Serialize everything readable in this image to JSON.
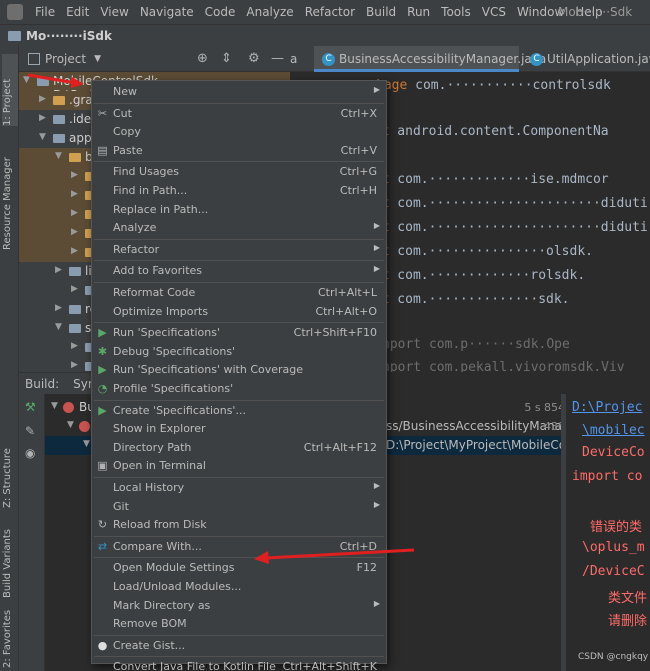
{
  "menubar": {
    "items": [
      "File",
      "Edit",
      "View",
      "Navigate",
      "Code",
      "Analyze",
      "Refactor",
      "Build",
      "Run",
      "Tools",
      "VCS",
      "Window",
      "Help"
    ],
    "window_title": "Mob·······Sdk"
  },
  "breadcrumb": {
    "project": "Mo········iSdk"
  },
  "left_strip": {
    "project_tab": "1: Project",
    "resource_manager_tab": "Resource Manager",
    "structure_tab": "Z: Structure",
    "build_variants_tab": "Build Variants",
    "favorites_tab": "2: Favorites"
  },
  "project_panel": {
    "title": "Project"
  },
  "tree": [
    {
      "label": "MobileControlSdk D:\\Project\\MyProject\\Mo...",
      "highlight": "hl"
    },
    {
      "label": ".grad",
      "highlight": "hl"
    },
    {
      "label": ".idea",
      "highlight": ""
    },
    {
      "label": "app",
      "highlight": ""
    },
    {
      "label": "b",
      "highlight": "hl"
    },
    {
      "label": "",
      "highlight": "hl"
    },
    {
      "label": "",
      "highlight": "hl"
    },
    {
      "label": "",
      "highlight": "hl"
    },
    {
      "label": "",
      "highlight": "hl"
    },
    {
      "label": "",
      "highlight": "hl"
    },
    {
      "label": "li",
      "highlight": ""
    },
    {
      "label": "",
      "highlight": ""
    },
    {
      "label": "re",
      "highlight": ""
    },
    {
      "label": "sr",
      "highlight": ""
    },
    {
      "label": "",
      "highlight": ""
    },
    {
      "label": "",
      "highlight": ""
    }
  ],
  "build_tabs": {
    "build_label": "Build:",
    "sync_label": "Sync"
  },
  "build_rows": [
    {
      "label": "Bu",
      "time": "5 s 854 ms",
      "path": ""
    },
    {
      "label": "",
      "time": "438 ms",
      "path": "ss/BusinessAccessibilityManager.java"
    },
    {
      "label": "",
      "time": "",
      "path": "D:\\Project\\MyProject\\MobileContro"
    }
  ],
  "output_lines": [
    "D:\\Projec",
    "\\mobilec",
    "DeviceCo",
    "import co",
    "错误的类",
    "\\oplus_m",
    "/DeviceC",
    "类文件",
    "请删除"
  ],
  "editor_tabs": {
    "first": "a",
    "active": "BusinessAccessibilityManager.java",
    "third": "UtilApplication.java"
  },
  "code_lines": [
    {
      "kw": "kage",
      "text": " com.···········controlsdk"
    },
    {
      "kw": "ort",
      "text": " android.content.ComponentNa"
    },
    {
      "kw": "ort",
      "text": " com.·············ise.mdmcor"
    },
    {
      "kw": "ort",
      "text": " com.······················diduti"
    },
    {
      "kw": "ort",
      "text": " com.······················diduti"
    },
    {
      "kw": "ort",
      "text": " com.···············olsdk."
    },
    {
      "kw": "ort",
      "text": " com.·············rolsdk."
    },
    {
      "kw": "ort",
      "text": " com.··············sdk."
    },
    {
      "kw": "",
      "text": "nport com.p······sdk.Ope"
    },
    {
      "kw": "",
      "text": "nport com.pekall.vivoromsdk.Viv"
    }
  ],
  "context_menu": [
    {
      "label": "New",
      "shortcut": "",
      "submenu": true,
      "icon": "",
      "icon_color": ""
    },
    {
      "sep": true
    },
    {
      "label": "Cut",
      "shortcut": "Ctrl+X",
      "submenu": false,
      "icon": "✂",
      "icon_color": "#afb1b3"
    },
    {
      "label": "Copy",
      "shortcut": "",
      "submenu": false,
      "icon": "",
      "icon_color": ""
    },
    {
      "label": "Paste",
      "shortcut": "Ctrl+V",
      "submenu": false,
      "icon": "▤",
      "icon_color": "#afb1b3"
    },
    {
      "sep": true
    },
    {
      "label": "Find Usages",
      "shortcut": "Ctrl+G",
      "submenu": false,
      "icon": "",
      "icon_color": ""
    },
    {
      "label": "Find in Path...",
      "shortcut": "Ctrl+H",
      "submenu": false,
      "icon": "",
      "icon_color": ""
    },
    {
      "label": "Replace in Path...",
      "shortcut": "",
      "submenu": false,
      "icon": "",
      "icon_color": ""
    },
    {
      "label": "Analyze",
      "shortcut": "",
      "submenu": true,
      "icon": "",
      "icon_color": ""
    },
    {
      "sep": true
    },
    {
      "label": "Refactor",
      "shortcut": "",
      "submenu": true,
      "icon": "",
      "icon_color": ""
    },
    {
      "sep": true
    },
    {
      "label": "Add to Favorites",
      "shortcut": "",
      "submenu": true,
      "icon": "",
      "icon_color": ""
    },
    {
      "sep": true
    },
    {
      "label": "Reformat Code",
      "shortcut": "Ctrl+Alt+L",
      "submenu": false,
      "icon": "",
      "icon_color": ""
    },
    {
      "label": "Optimize Imports",
      "shortcut": "Ctrl+Alt+O",
      "submenu": false,
      "icon": "",
      "icon_color": ""
    },
    {
      "sep": true
    },
    {
      "label": "Run 'Specifications'",
      "shortcut": "Ctrl+Shift+F10",
      "submenu": false,
      "icon": "▶",
      "icon_color": "#59a869"
    },
    {
      "label": "Debug 'Specifications'",
      "shortcut": "",
      "submenu": false,
      "icon": "✱",
      "icon_color": "#59a869"
    },
    {
      "label": "Run 'Specifications' with Coverage",
      "shortcut": "",
      "submenu": false,
      "icon": "▶",
      "icon_color": "#59a869"
    },
    {
      "label": "Profile 'Specifications'",
      "shortcut": "",
      "submenu": false,
      "icon": "◔",
      "icon_color": "#59a869"
    },
    {
      "sep": true
    },
    {
      "label": "Create 'Specifications'...",
      "shortcut": "",
      "submenu": false,
      "icon": "▶",
      "icon_color": "#59a869"
    },
    {
      "label": "Show in Explorer",
      "shortcut": "",
      "submenu": false,
      "icon": "",
      "icon_color": ""
    },
    {
      "label": "Directory Path",
      "shortcut": "Ctrl+Alt+F12",
      "submenu": false,
      "icon": "",
      "icon_color": ""
    },
    {
      "label": "Open in Terminal",
      "shortcut": "",
      "submenu": false,
      "icon": "▣",
      "icon_color": "#afb1b3"
    },
    {
      "sep": true
    },
    {
      "label": "Local History",
      "shortcut": "",
      "submenu": true,
      "icon": "",
      "icon_color": ""
    },
    {
      "label": "Git",
      "shortcut": "",
      "submenu": true,
      "icon": "",
      "icon_color": ""
    },
    {
      "label": "Reload from Disk",
      "shortcut": "",
      "submenu": false,
      "icon": "↻",
      "icon_color": "#afb1b3"
    },
    {
      "sep": true
    },
    {
      "label": "Compare With...",
      "shortcut": "Ctrl+D",
      "submenu": false,
      "icon": "⇄",
      "icon_color": "#3592c4"
    },
    {
      "sep": true
    },
    {
      "label": "Open Module Settings",
      "shortcut": "F12",
      "submenu": false,
      "icon": "",
      "icon_color": ""
    },
    {
      "label": "Load/Unload Modules...",
      "shortcut": "",
      "submenu": false,
      "icon": "",
      "icon_color": ""
    },
    {
      "label": "Mark Directory as",
      "shortcut": "",
      "submenu": true,
      "icon": "",
      "icon_color": ""
    },
    {
      "label": "Remove BOM",
      "shortcut": "",
      "submenu": false,
      "icon": "",
      "icon_color": ""
    },
    {
      "sep": true
    },
    {
      "label": "Create Gist...",
      "shortcut": "",
      "submenu": false,
      "icon": "●",
      "icon_color": "#dddddd"
    },
    {
      "sep": true
    },
    {
      "label": "Convert Java File to Kotlin File",
      "shortcut": "Ctrl+Alt+Shift+K",
      "submenu": false,
      "icon": "",
      "icon_color": ""
    }
  ],
  "watermark": "CSDN @cngkqy"
}
